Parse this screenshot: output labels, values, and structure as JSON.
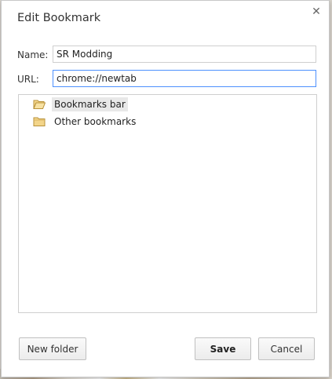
{
  "dialog": {
    "title": "Edit Bookmark",
    "close_glyph": "✕"
  },
  "form": {
    "name_label": "Name:",
    "name_value": "SR Modding",
    "url_label": "URL:",
    "url_value": "chrome://newtab"
  },
  "tree": {
    "items": [
      {
        "label": "Bookmarks bar",
        "icon": "folder-open-icon",
        "selected": true
      },
      {
        "label": "Other bookmarks",
        "icon": "folder-icon",
        "selected": false
      }
    ]
  },
  "buttons": {
    "new_folder": "New folder",
    "save": "Save",
    "cancel": "Cancel"
  },
  "colors": {
    "focus_border": "#4d90fe",
    "folder_fill": "#f3d58a",
    "folder_stroke": "#b8923a"
  }
}
